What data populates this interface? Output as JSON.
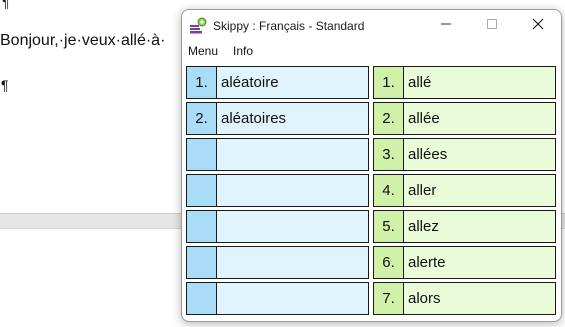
{
  "document": {
    "top_mark": "¶",
    "line1": "Bonjour,·je·veux·allé·à·",
    "paragraph_mark": "¶"
  },
  "window": {
    "title": "Skippy : Français - Standard",
    "menu": [
      "Menu",
      "Info"
    ]
  },
  "left_suggestions": [
    {
      "num": "1.",
      "word": "aléatoire"
    },
    {
      "num": "2.",
      "word": "aléatoires"
    },
    {
      "num": "",
      "word": ""
    },
    {
      "num": "",
      "word": ""
    },
    {
      "num": "",
      "word": ""
    },
    {
      "num": "",
      "word": ""
    },
    {
      "num": "",
      "word": ""
    }
  ],
  "right_suggestions": [
    {
      "num": "1.",
      "word": "allé"
    },
    {
      "num": "2.",
      "word": "allée"
    },
    {
      "num": "3.",
      "word": "allées"
    },
    {
      "num": "4.",
      "word": "aller"
    },
    {
      "num": "5.",
      "word": "allez"
    },
    {
      "num": "6.",
      "word": "alerte"
    },
    {
      "num": "7.",
      "word": "alors"
    }
  ],
  "icons": {
    "app": "skippy-app-icon",
    "minimize": "minimize-icon",
    "maximize": "maximize-icon",
    "close": "close-icon"
  },
  "colors": {
    "left_cell": "#dff4fd",
    "left_num": "#a9dcf7",
    "right_cell": "#e9fbd9",
    "right_num": "#cff2a8"
  }
}
